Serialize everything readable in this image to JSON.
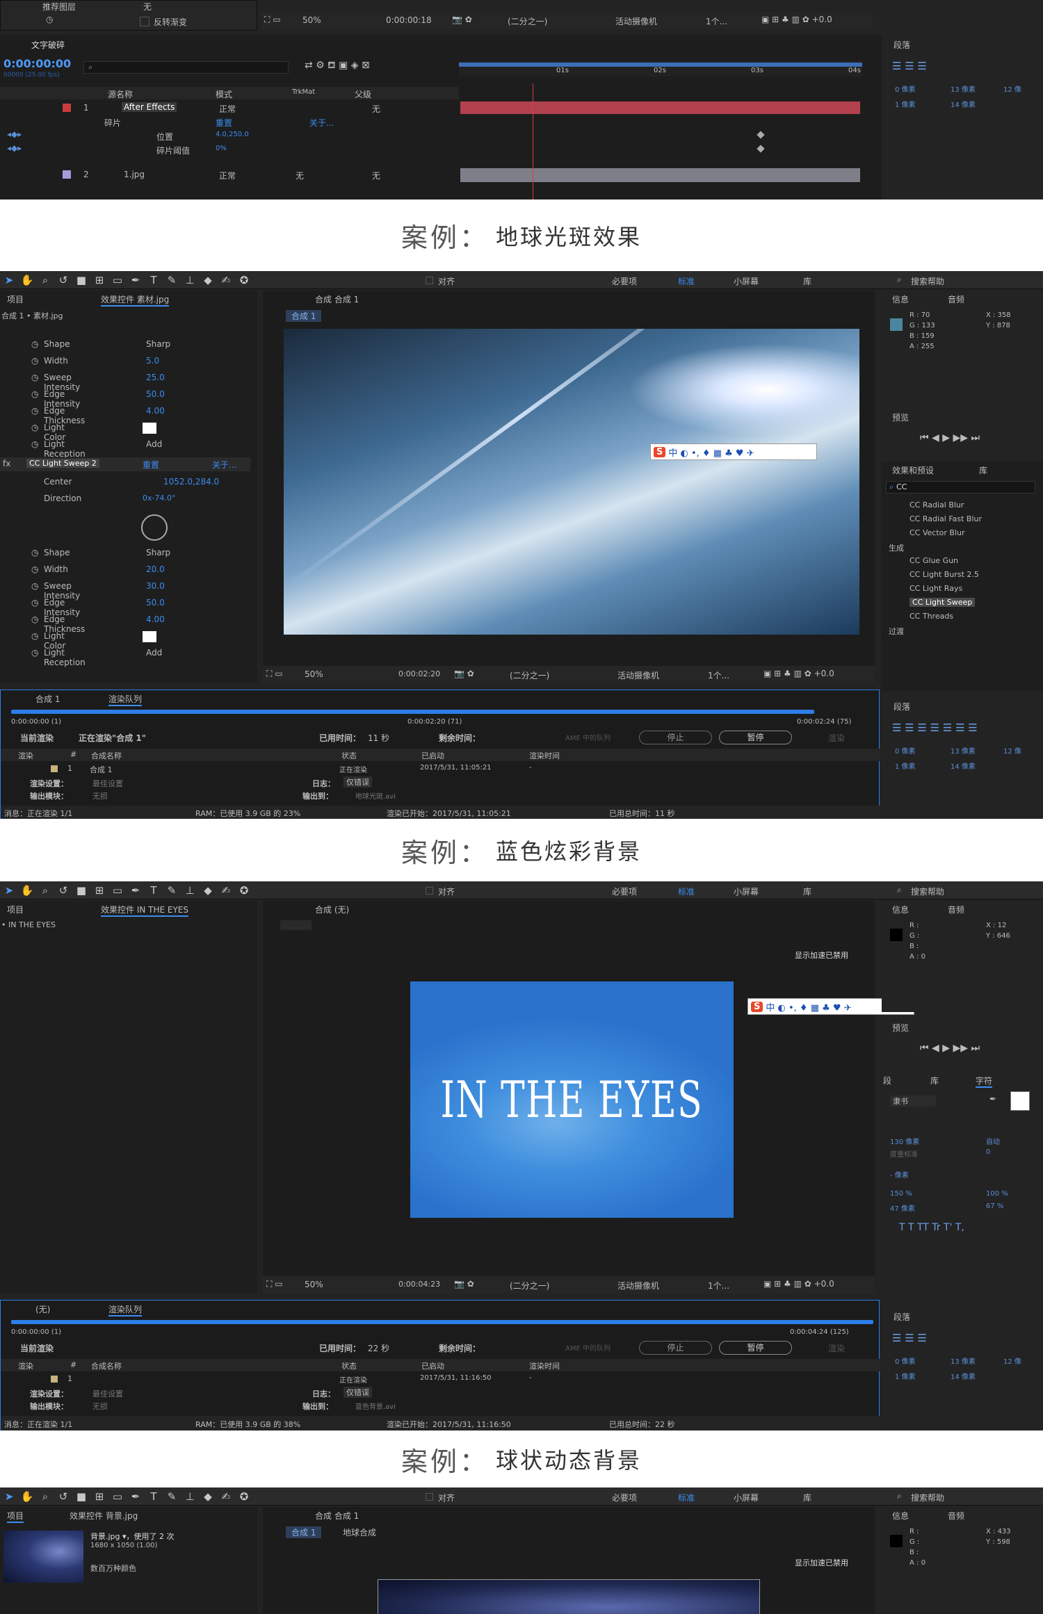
{
  "panel1": {
    "top_left": {
      "label1": "推荐图层",
      "val1": "无",
      "label2": "反转渐变"
    },
    "viewer_bar": {
      "zoom": "50%",
      "timecode": "0:00:00:18",
      "res": "(二分之一)",
      "camera": "活动摄像机",
      "views": "1个..."
    },
    "timeline": {
      "tab": "文字破碎",
      "timecode": "0:00:00:00",
      "fps": "00000 (25.00 fps)",
      "cols": {
        "name": "源名称",
        "mode": "模式",
        "trk": "TrkMat",
        "parent": "父级"
      },
      "ruler": [
        "01s",
        "02s",
        "03s",
        "04s"
      ],
      "layer1": {
        "num": "1",
        "name": "After Effects",
        "mode": "正常",
        "parent": "无"
      },
      "sub1": "碎片",
      "sub1_val": "重置",
      "sub1_about": "关于...",
      "prop1": "位置",
      "prop1_val": "4.0,250.0",
      "prop2": "碎片阈值",
      "prop2_val": "0%",
      "layer2": {
        "num": "2",
        "name": "1.jpg",
        "mode": "正常",
        "trk": "无",
        "parent": "无"
      }
    },
    "paragraph": {
      "title": "段落",
      "vals": [
        "0 像素",
        "13 像素",
        "12 像",
        "1 像素",
        "14 像素"
      ]
    }
  },
  "caption1": {
    "label": "案例：",
    "title": "地球光斑效果"
  },
  "panel2": {
    "toolbar": {
      "align": "对齐",
      "ws1": "必要项",
      "ws2": "标准",
      "ws3": "小屏幕",
      "ws4": "库",
      "search": "搜索帮助"
    },
    "left": {
      "tab1": "项目",
      "tab2": "效果控件 素材.jpg",
      "crumb": "合成 1 • 素材.jpg",
      "props": [
        {
          "name": "Shape",
          "val": "Sharp"
        },
        {
          "name": "Width",
          "val": "5.0"
        },
        {
          "name": "Sweep Intensity",
          "val": "25.0"
        },
        {
          "name": "Edge Intensity",
          "val": "50.0"
        },
        {
          "name": "Edge Thickness",
          "val": "4.00"
        },
        {
          "name": "Light Color",
          "val": ""
        },
        {
          "name": "Light Reception",
          "val": "Add"
        }
      ],
      "effect": "CC Light Sweep 2",
      "effect_reset": "重置",
      "effect_about": "关于...",
      "center": "Center",
      "center_val": "1052.0,284.0",
      "direction": "Direction",
      "direction_val": "0x-74.0°",
      "props2": [
        {
          "name": "Shape",
          "val": "Sharp"
        },
        {
          "name": "Width",
          "val": "20.0"
        },
        {
          "name": "Sweep Intensity",
          "val": "30.0"
        },
        {
          "name": "Edge Intensity",
          "val": "50.0"
        },
        {
          "name": "Edge Thickness",
          "val": "4.00"
        },
        {
          "name": "Light Color",
          "val": ""
        },
        {
          "name": "Light Reception",
          "val": "Add"
        }
      ]
    },
    "viewer": {
      "tab": "合成 合成 1",
      "crumb": "合成 1",
      "zoom": "50%",
      "timecode": "0:00:02:20",
      "res": "(二分之一)",
      "camera": "活动摄像机",
      "views": "1个..."
    },
    "ime": {
      "logo": "S",
      "glyphs": "中 ◐ •, ♦ ▦ ♣ ♥ ✈"
    },
    "info": {
      "tab1": "信息",
      "tab2": "音频",
      "r": "R : 70",
      "g": "G : 133",
      "b": "B : 159",
      "a": "A : 255",
      "x": "X : 358",
      "y": "Y : 878",
      "swatch": "#4a86a0"
    },
    "preview": {
      "title": "预览"
    },
    "effects": {
      "tab1": "效果和预设",
      "tab2": "库",
      "search": "CC",
      "items": [
        "CC Radial Blur",
        "CC Radial Fast Blur",
        "CC Vector Blur"
      ],
      "group1": "生成",
      "items2": [
        "CC Glue Gun",
        "CC Light Burst 2.5",
        "CC Light Rays",
        "CC Light Sweep",
        "CC Threads"
      ],
      "group2": "过渡"
    },
    "render": {
      "tab1": "合成 1",
      "tab2": "渲染队列",
      "t_start": "0:00:00:00 (1)",
      "t_mid": "0:00:02:20 (71)",
      "t_end": "0:00:02:24 (75)",
      "current": "当前渲染",
      "rendering": "正在渲染\"合成 1\"",
      "elapsed_label": "已用时间：",
      "elapsed": "11 秒",
      "remaining_label": "剩余时间：",
      "ame": "AME 中的队列",
      "stop": "停止",
      "pause": "暂停",
      "render_btn": "渲染",
      "cols": [
        "渲染",
        "#",
        "合成名称",
        "状态",
        "已启动",
        "渲染时间"
      ],
      "row": {
        "num": "1",
        "name": "合成 1",
        "status": "正在渲染",
        "started": "2017/5/31, 11:05:21",
        "time": "-"
      },
      "settings": "渲染设置：",
      "settings_val": "最佳设置",
      "log": "日志：",
      "log_val": "仅错误",
      "output": "输出模块：",
      "output_val": "无损",
      "output_to": "输出到：",
      "output_file": "地球光斑.avi",
      "status_msg": "消息：正在渲染 1/1",
      "ram": "RAM：已使用 3.9 GB 的 23%",
      "render_started": "渲染已开始：2017/5/31, 11:05:21",
      "total_elapsed": "已用总时间：11 秒"
    },
    "paragraph": {
      "title": "段落",
      "vals": [
        "0 像素",
        "13 像素",
        "12 像",
        "1 像素",
        "14 像素"
      ]
    }
  },
  "caption2": {
    "label": "案例：",
    "title": "蓝色炫彩背景"
  },
  "panel3": {
    "left": {
      "tab1": "项目",
      "tab2": "效果控件 IN THE EYES",
      "crumb": "• IN THE EYES"
    },
    "viewer": {
      "tab": "合成 (无)",
      "notice": "显示加速已禁用",
      "title_text": "IN THE EYES",
      "zoom": "50%",
      "timecode": "0:00:04:23",
      "res": "(二分之一)",
      "camera": "活动摄像机",
      "views": "1个..."
    },
    "info": {
      "tab1": "信息",
      "tab2": "音频",
      "r": "R :",
      "g": "G :",
      "b": "B :",
      "a": "A : 0",
      "x": "X : 12",
      "y": "Y : 646"
    },
    "preview": {
      "title": "预览"
    },
    "character": {
      "tab1": "段",
      "tab2": "库",
      "tab3": "字符",
      "font": "隶书",
      "size": "130 像素",
      "auto": "自动",
      "track_label": "度量标准",
      "track_val": "0",
      "leading": "- 像素",
      "vscale": "150 %",
      "hscale": "100 %",
      "baseline": "47 像素",
      "tsume": "67 %"
    },
    "render": {
      "tab1": "(无)",
      "tab2": "渲染队列",
      "t_start": "0:00:00:00 (1)",
      "t_end": "0:00:04:24 (125)",
      "current": "当前渲染",
      "elapsed_label": "已用时间：",
      "elapsed": "22 秒",
      "remaining_label": "剩余时间：",
      "ame": "AME 中的队列",
      "stop": "停止",
      "pause": "暂停",
      "render_btn": "渲染",
      "cols": [
        "渲染",
        "#",
        "合成名称",
        "状态",
        "已启动",
        "渲染时间"
      ],
      "row": {
        "num": "1",
        "name": "",
        "status": "正在渲染",
        "started": "2017/5/31, 11:16:50",
        "time": "-"
      },
      "settings": "渲染设置：",
      "settings_val": "最佳设置",
      "log": "日志：",
      "log_val": "仅错误",
      "output": "输出模块：",
      "output_val": "无损",
      "output_to": "输出到：",
      "output_file": "蓝色背景.avi",
      "status_msg": "消息：正在渲染 1/1",
      "ram": "RAM：已使用 3.9 GB 的 38%",
      "render_started": "渲染已开始：2017/5/31, 11:16:50",
      "total_elapsed": "已用总时间：22 秒"
    },
    "paragraph": {
      "title": "段落",
      "vals": [
        "0 像素",
        "13 像素",
        "12 像",
        "1 像素",
        "14 像素"
      ]
    }
  },
  "caption3": {
    "label": "案例：",
    "title": "球状动态背景"
  },
  "panel4": {
    "left": {
      "tab1": "项目",
      "tab2": "效果控件 背景.jpg",
      "file": "背景.jpg ▾，使用了 2 次",
      "dims": "1680 x 1050 (1.00)",
      "colors": "数百万种颜色"
    },
    "viewer": {
      "tab": "合成 合成 1",
      "crumb1": "合成 1",
      "crumb2": "地球合成",
      "notice": "显示加速已禁用"
    },
    "info": {
      "tab1": "信息",
      "tab2": "音频",
      "r": "R :",
      "g": "G :",
      "b": "B :",
      "a": "A : 0",
      "x": "X : 433",
      "y": "Y : 598"
    }
  }
}
